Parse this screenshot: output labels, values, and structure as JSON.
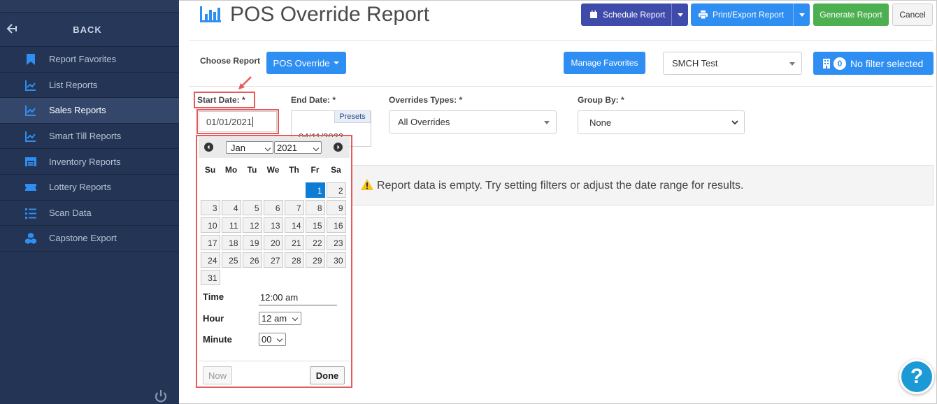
{
  "sidebar": {
    "back_label": "BACK",
    "items": [
      {
        "label": "Report Favorites",
        "icon": "bookmark-icon"
      },
      {
        "label": "List Reports",
        "icon": "chart-line-icon"
      },
      {
        "label": "Sales Reports",
        "icon": "chart-line-icon",
        "active": true
      },
      {
        "label": "Smart Till Reports",
        "icon": "chart-line-icon"
      },
      {
        "label": "Inventory Reports",
        "icon": "warehouse-icon"
      },
      {
        "label": "Lottery Reports",
        "icon": "ticket-icon"
      },
      {
        "label": "Scan Data",
        "icon": "list-icon"
      },
      {
        "label": "Capstone Export",
        "icon": "cubes-icon"
      }
    ]
  },
  "header": {
    "title": "POS Override Report",
    "schedule_label": "Schedule Report",
    "print_label": "Print/Export Report",
    "generate_label": "Generate Report",
    "cancel_label": "Cancel"
  },
  "filters": {
    "choose_report_label": "Choose Report",
    "report_value": "POS Override",
    "manage_favorites_label": "Manage Favorites",
    "store_value": "SMCH Test",
    "filter_count": "0",
    "filter_label": "No filter selected",
    "start_date_label": "Start Date: *",
    "start_date_value": "01/01/2021",
    "end_date_label": "End Date: *",
    "end_date_value": "04/11/2022",
    "presets_label": "Presets",
    "overrides_label": "Overrides Types: *",
    "overrides_value": "All Overrides",
    "group_by_label": "Group By: *",
    "group_by_value": "None"
  },
  "message": {
    "empty_text": "Report data is empty. Try setting filters or adjust the date range for results."
  },
  "datepicker": {
    "month": "Jan",
    "year": "2021",
    "weekdays": [
      "Su",
      "Mo",
      "Tu",
      "We",
      "Th",
      "Fr",
      "Sa"
    ],
    "selected_day": 1,
    "time_label": "Time",
    "time_value": "12:00 am",
    "hour_label": "Hour",
    "hour_value": "12 am",
    "minute_label": "Minute",
    "minute_value": "00",
    "now_label": "Now",
    "done_label": "Done"
  },
  "help_label": "?",
  "colors": {
    "sidebar_bg": "#243454",
    "primary_blue": "#2f8ef2",
    "indigo": "#3f4bab",
    "green": "#4caf50",
    "highlight_red": "#e55a5a",
    "selected_day": "#0c7cd5"
  }
}
